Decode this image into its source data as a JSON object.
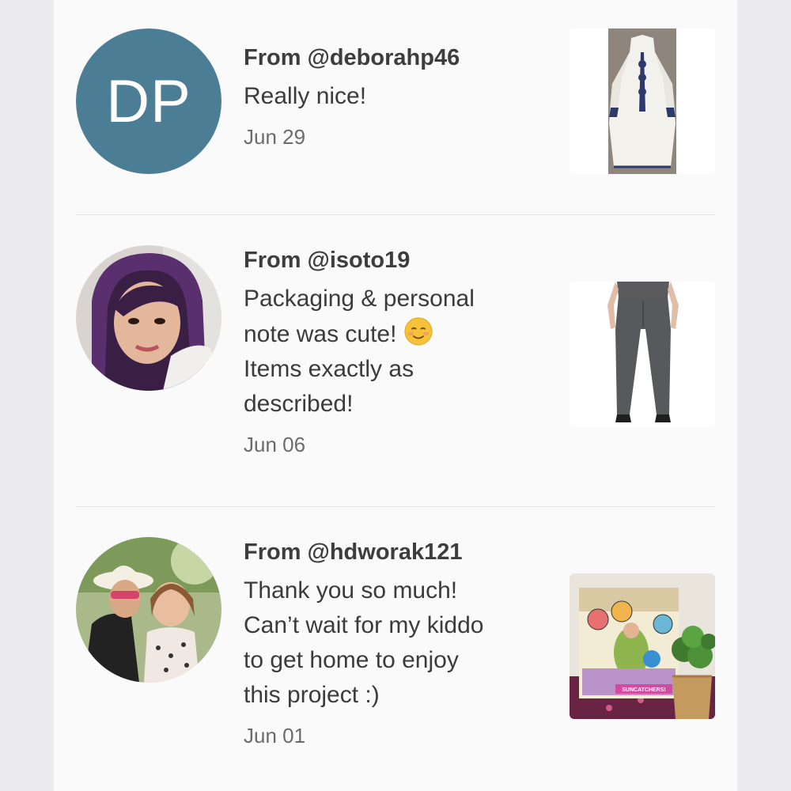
{
  "reviews": [
    {
      "from": "From @deborahp46",
      "message": "Really nice!",
      "date": "Jun 29",
      "avatar_initials": "DP",
      "avatar_color": "#4b7d95",
      "item_icon": "white-embroidered-dress"
    },
    {
      "from": "From @isoto19",
      "message_lines": [
        "Packaging & personal",
        "note was cute!",
        "Items exactly as",
        "described!"
      ],
      "emoji": "smiling-face-icon",
      "date": "Jun 06",
      "avatar_icon": "user-photo-purple-hair",
      "item_icon": "gray-pants"
    },
    {
      "from": "From @hdworak121",
      "message_lines": [
        "Thank you so much!",
        "Can’t wait for my kiddo",
        "to get home to enjoy",
        "this project :)"
      ],
      "date": "Jun 01",
      "avatar_icon": "user-photo-mom-and-child",
      "item_icon": "princess-suncatchers-kit",
      "item_box_label": "SUNCATCHERS!"
    }
  ]
}
